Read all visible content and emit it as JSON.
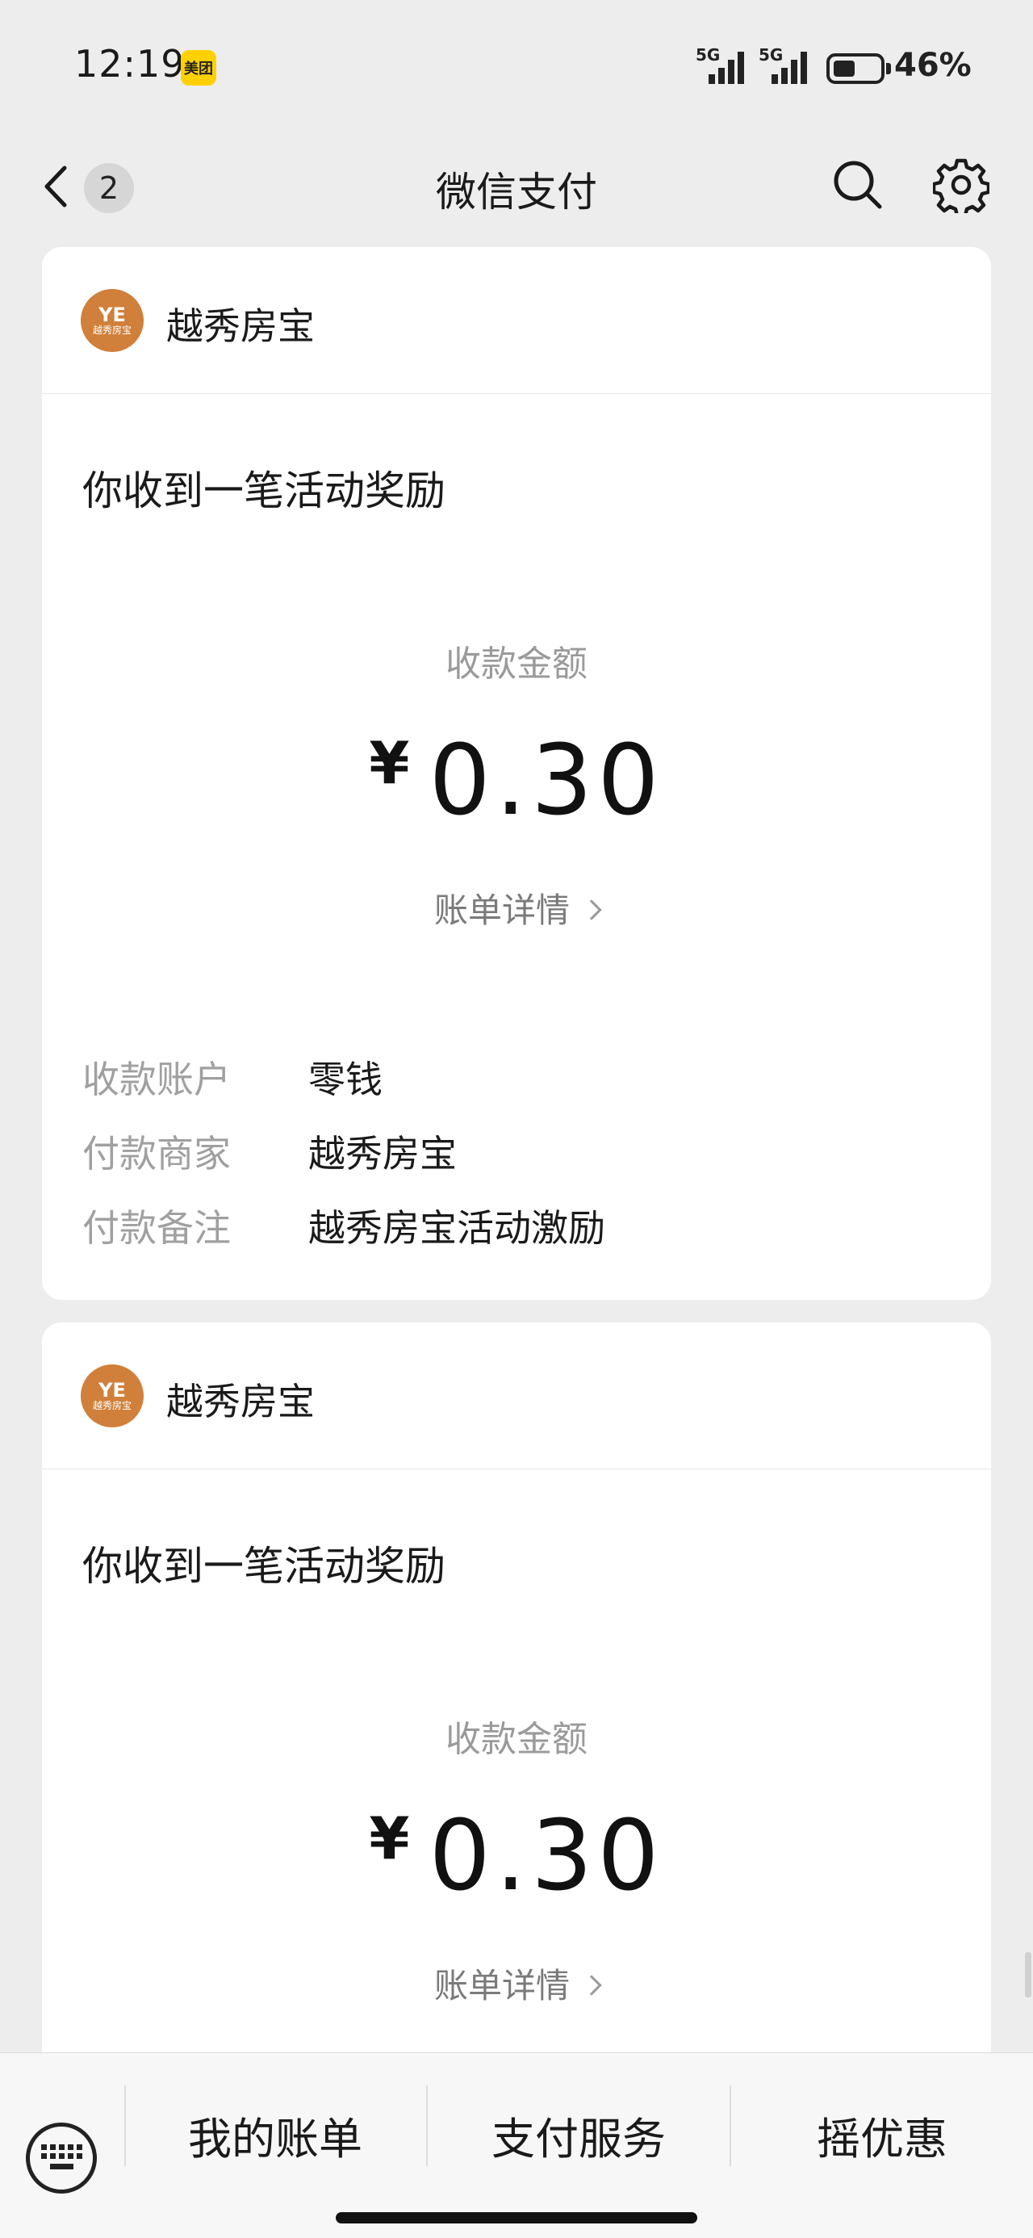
{
  "status_bar": {
    "time": "12:19",
    "app_badge": "美团",
    "signal1_label": "5G",
    "signal2_label": "5G",
    "battery_percent": "46%",
    "battery_level": 0.46
  },
  "nav": {
    "unread_count": "2",
    "title": "微信支付"
  },
  "cards": [
    {
      "merchant": "越秀房宝",
      "logo_text": "越秀房宝",
      "message_title": "你收到一笔活动奖励",
      "amount_label": "收款金额",
      "currency": "¥",
      "amount": "0.30",
      "detail_link": "账单详情",
      "rows": [
        {
          "key": "收款账户",
          "value": "零钱"
        },
        {
          "key": "付款商家",
          "value": "越秀房宝"
        },
        {
          "key": "付款备注",
          "value": "越秀房宝活动激励"
        }
      ]
    },
    {
      "merchant": "越秀房宝",
      "logo_text": "越秀房宝",
      "message_title": "你收到一笔活动奖励",
      "amount_label": "收款金额",
      "currency": "¥",
      "amount": "0.30",
      "detail_link": "账单详情"
    }
  ],
  "bottom_menu": {
    "items": [
      "我的账单",
      "支付服务",
      "摇优惠"
    ]
  },
  "colors": {
    "background": "#ededed",
    "card": "#ffffff",
    "logo": "#d0803a",
    "app_badge": "#ffd100"
  }
}
